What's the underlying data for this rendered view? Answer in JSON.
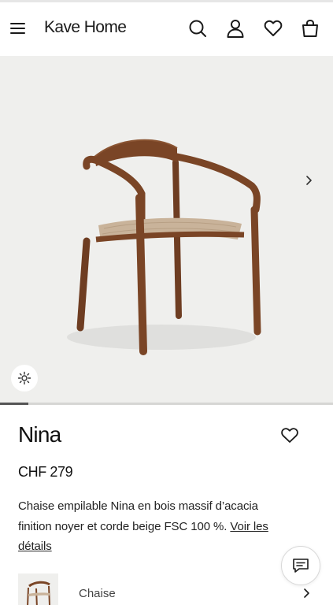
{
  "header": {
    "logo": "Kave Home",
    "icons": [
      "menu-icon",
      "search-icon",
      "account-icon",
      "heart-icon",
      "bag-icon"
    ]
  },
  "gallery": {
    "image_alt": "chair",
    "progress": 0.085
  },
  "product": {
    "name": "Nina",
    "price": "CHF 279",
    "description": "Chaise empilable Nina en bois massif d’acacia finition noyer et corde beige FSC 100 %.",
    "details_link": "Voir les détails"
  },
  "variant": {
    "label": "Chaise"
  },
  "colors": {
    "gallery_bg": "#efefed",
    "text": "#1a1a1a",
    "wood": "#7a4526",
    "rope": "#c9b39a"
  }
}
